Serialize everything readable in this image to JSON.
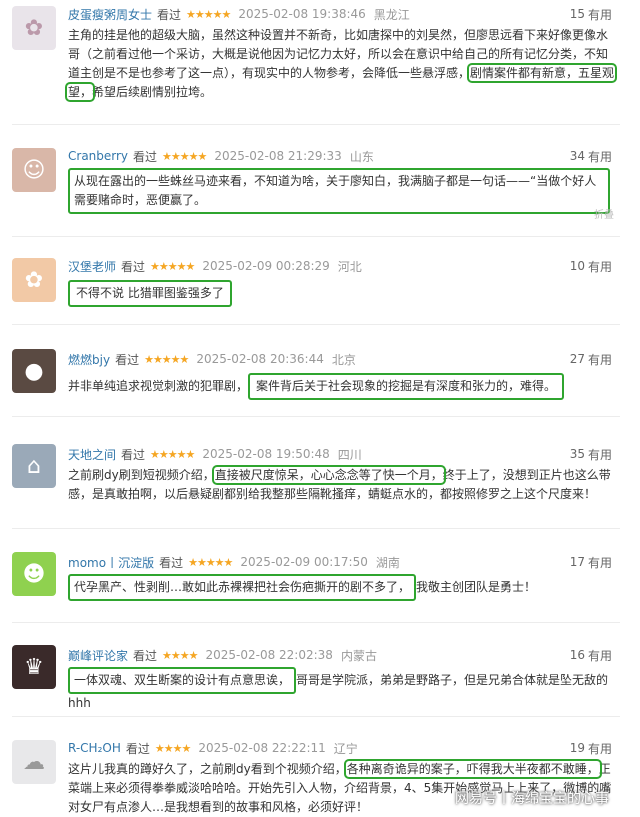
{
  "reviews": [
    {
      "user": "皮蛋瘦粥周女士",
      "status": "看过",
      "stars": "★★★★★",
      "time": "2025-02-08 19:38:46",
      "location": "黑龙江",
      "votes": "15",
      "votes_label": "有用",
      "text_pre": "主角的挂是他的超级大脑，虽然这种设置并不新奇，比如唐探中的刘昊然，但廖思远看下来好像更像水哥（之前看过他一个采访，大概是说他因为记忆力太好，所以会在意识中给自己的所有记忆分类，不知道主创是不是也参考了这一点），有现实中的人物参考，会降低一些悬浮感，",
      "highlight": "剧情案件都有新意，五星观望，",
      "text_post": "希望后续剧情别拉垮。"
    },
    {
      "user": "Cranberry",
      "status": "看过",
      "stars": "★★★★★",
      "time": "2025-02-08 21:29:33",
      "location": "山东",
      "votes": "34",
      "votes_label": "有用",
      "text_pre": "",
      "highlight": "从现在露出的一些蛛丝马迹来看，不知道为啥，关于廖知白，我满脑子都是一句话——“当做个好人需要赌命时，恶便赢了。",
      "text_post": "",
      "fold": "折叠"
    },
    {
      "user": "汉堡老师",
      "status": "看过",
      "stars": "★★★★★",
      "time": "2025-02-09 00:28:29",
      "location": "河北",
      "votes": "10",
      "votes_label": "有用",
      "text_pre": "",
      "highlight": "不得不说 比猎罪图鉴强多了",
      "text_post": ""
    },
    {
      "user": "燃燃bjy",
      "status": "看过",
      "stars": "★★★★★",
      "time": "2025-02-08 20:36:44",
      "location": "北京",
      "votes": "27",
      "votes_label": "有用",
      "text_pre": "并非单纯追求视觉刺激的犯罪剧，",
      "highlight": "案件背后关于社会现象的挖掘是有深度和张力的，难得。",
      "text_post": ""
    },
    {
      "user": "天地之间",
      "status": "看过",
      "stars": "★★★★★",
      "time": "2025-02-08 19:50:48",
      "location": "四川",
      "votes": "35",
      "votes_label": "有用",
      "text_pre": "之前刷dy刷到短视频介绍，",
      "highlight": "直接被尺度惊呆，心心念念等了快一个月，",
      "text_post": "终于上了，没想到正片也这么带感，是真敢拍啊，以后悬疑剧都别给我整那些隔靴搔痒，蜻蜓点水的，都按照修罗之上这个尺度来！"
    },
    {
      "user": "momo丨沉淀版",
      "status": "看过",
      "stars": "★★★★★",
      "time": "2025-02-09 00:17:50",
      "location": "湖南",
      "votes": "17",
      "votes_label": "有用",
      "text_pre": "",
      "highlight": "代孕黑产、性剥削…敢如此赤裸裸把社会伤疤撕开的剧不多了，",
      "text_post": "我敬主创团队是勇士！"
    },
    {
      "user": "巅峰评论家",
      "status": "看过",
      "stars": "★★★★",
      "time": "2025-02-08 22:02:38",
      "location": "内蒙古",
      "votes": "16",
      "votes_label": "有用",
      "text_pre": "",
      "highlight": "一体双魂、双生断案的设计有点意思诶，",
      "text_post": "哥哥是学院派，弟弟是野路子，但是兄弟合体就是坠无敌的hhh"
    },
    {
      "user": "R-CH₂OH",
      "status": "看过",
      "stars": "★★★★",
      "time": "2025-02-08 22:22:11",
      "location": "辽宁",
      "votes": "19",
      "votes_label": "有用",
      "text_pre": "这片儿我真的蹲好久了，之前刷dy看到个视频介绍，",
      "highlight": "各种离奇诡异的案子，吓得我大半夜都不敢睡，",
      "text_post": "正菜端上来必须得拳拳威淡哈哈哈。开始先引入人物，介绍背景，4、5集开始感觉马上上来了，微博的嘴对女尸有点渗人…是我想看到的故事和风格，必须好评！"
    }
  ],
  "watermark": "网易号丨海绵宝宝的心事",
  "colors": {
    "accent_green": "#2fa52f",
    "star": "#f5a623",
    "link": "#3377aa"
  }
}
